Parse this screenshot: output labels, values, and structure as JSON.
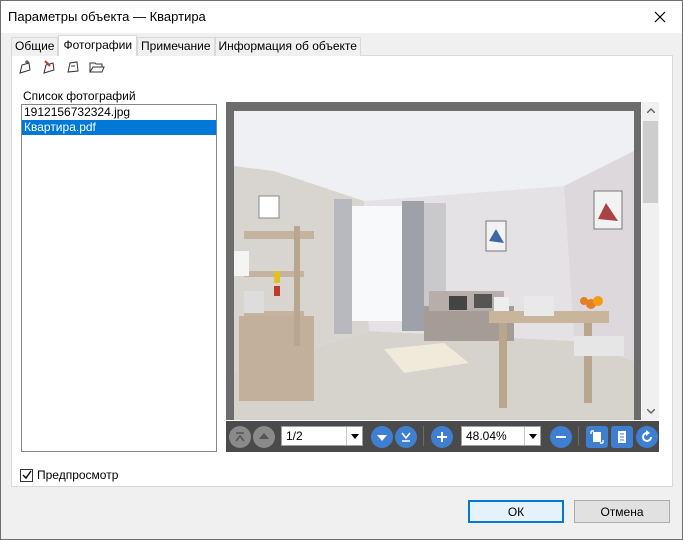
{
  "window": {
    "title": "Параметры объекта — Квартира"
  },
  "tabs": [
    {
      "label": "Общие",
      "active": false
    },
    {
      "label": "Фотографии",
      "active": true
    },
    {
      "label": "Примечание",
      "active": false
    },
    {
      "label": "Информация об объекте",
      "active": false
    }
  ],
  "toolbar": {
    "icons": [
      "add-photo-icon",
      "edit-photo-icon",
      "remove-photo-icon",
      "open-folder-icon"
    ]
  },
  "photos": {
    "label": "Список фотографий",
    "items": [
      "1912156732324.jpg",
      "Квартира.pdf"
    ],
    "selected_index": 1
  },
  "viewer": {
    "page": "1/2",
    "zoom": "48.04%"
  },
  "preview": {
    "label": "Предпросмотр",
    "checked": true
  },
  "buttons": {
    "ok": "ОК",
    "cancel": "Отмена"
  },
  "colors": {
    "selection": "#0078d7",
    "toolbar_bg": "#4a4a4a",
    "nav_blue": "#3f7fd1"
  }
}
